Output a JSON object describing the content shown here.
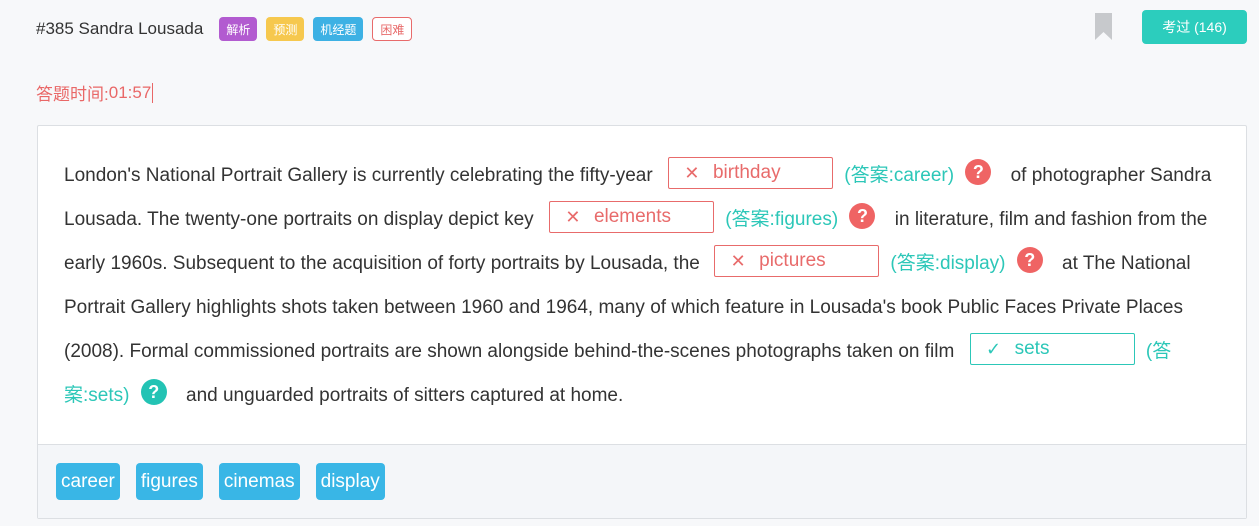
{
  "header": {
    "title": "#385 Sandra Lousada",
    "tags": [
      "解析",
      "预测",
      "机经题",
      "困难"
    ],
    "pass_button": "考过 (146)"
  },
  "timer": {
    "label": "答题时间:",
    "value": "01:57"
  },
  "passage": {
    "seg0": "London's National Portrait Gallery is currently celebrating the fifty-year",
    "blank1": {
      "user": "birthday",
      "mark": "✕",
      "answer": "(答案:career)"
    },
    "seg1": "of photographer Sandra Lousada. The twenty-one portraits on display depict key",
    "blank2": {
      "user": "elements",
      "mark": "✕",
      "answer": "(答案:figures)"
    },
    "seg2": "in literature, film and fashion from the early 1960s. Subsequent to the acquisition of forty portraits by Lousada, the",
    "blank3": {
      "user": "pictures",
      "mark": "✕",
      "answer": "(答案:display)"
    },
    "seg3": "at The National Portrait Gallery highlights shots taken between 1960 and 1964, many of which feature in Lousada's book Public Faces Private Places (2008). Formal commissioned portraits are shown alongside behind-the-scenes photographs taken on film",
    "blank4": {
      "user": "sets",
      "mark": "✓",
      "answer": "(答案:sets)"
    },
    "seg4": "and unguarded portraits of sitters captured at home."
  },
  "options": [
    "career",
    "figures",
    "cinemas",
    "display"
  ],
  "question_icon": "?",
  "colors": {
    "wrong": "#e86b6b",
    "right": "#2cc7b8",
    "accent": "#2ccdbd",
    "option_bg": "#39b6e6"
  }
}
